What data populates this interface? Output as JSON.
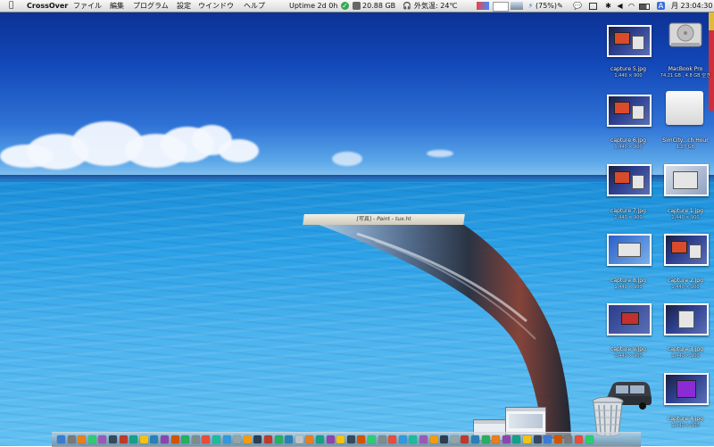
{
  "menubar": {
    "apple_icon": "apple-icon",
    "app_name": "CrossOver",
    "menus": [
      "ファイル",
      "編集",
      "プログラム",
      "設定",
      "ウインドウ",
      "ヘルプ"
    ],
    "uptime": "Uptime 2d 0h",
    "disk_free": "20.88 GB",
    "temperature": "外気温: 24℃",
    "battery": "(75%)",
    "clock": "月 23:04:30"
  },
  "desktop": {
    "icons": [
      {
        "name": "capture 5.jpg",
        "sub": "1,440 × 900"
      },
      {
        "name": "MacBook Pro",
        "sub": "74.21 GB , 4.8 GB 空き"
      },
      {
        "name": "capture 6.jpg",
        "sub": "1,440 × 900"
      },
      {
        "name": "SimCity...ch Hour",
        "sub": "1.27 GB"
      },
      {
        "name": "capture 7.jpg",
        "sub": "1,440 × 900"
      },
      {
        "name": "capture 1.jpg",
        "sub": "1,440 × 900"
      },
      {
        "name": "capture 8.jpg",
        "sub": "1,440 × 900"
      },
      {
        "name": "capture 2.jpg",
        "sub": "1,440 × 900"
      },
      {
        "name": "capture 9.jpg",
        "sub": "1,440 × 900"
      },
      {
        "name": "capture 3.jpg",
        "sub": "1,440 × 900"
      },
      {
        "name": "capture 4.jpg",
        "sub": "1,440 × 900"
      }
    ]
  },
  "genie_window": {
    "title": "[写真] - Paint - tux.ht"
  },
  "dock": {
    "app_colors": [
      "#3a7bd5",
      "#7a7a7a",
      "#e67e22",
      "#2ecc71",
      "#9b59b6",
      "#34495e",
      "#c0392b",
      "#16a085",
      "#f1c40f",
      "#2980b9",
      "#8e44ad",
      "#d35400",
      "#27ae60",
      "#7f8c8d",
      "#e74c3c",
      "#1abc9c",
      "#3498db",
      "#95a5a6",
      "#f39c12",
      "#2c3e50",
      "#c0392b",
      "#27ae60",
      "#2980b9",
      "#bdc3c7",
      "#e67e22",
      "#16a085",
      "#8e44ad",
      "#f1c40f",
      "#34495e",
      "#d35400",
      "#2ecc71",
      "#7f8c8d",
      "#e74c3c",
      "#3498db",
      "#1abc9c",
      "#9b59b6",
      "#f39c12",
      "#2c3e50",
      "#95a5a6",
      "#c0392b",
      "#2980b9",
      "#27ae60",
      "#e67e22",
      "#8e44ad",
      "#16a085",
      "#f1c40f",
      "#34495e",
      "#3a7bd5",
      "#d35400",
      "#7a7a7a",
      "#e74c3c",
      "#2ecc71"
    ]
  }
}
